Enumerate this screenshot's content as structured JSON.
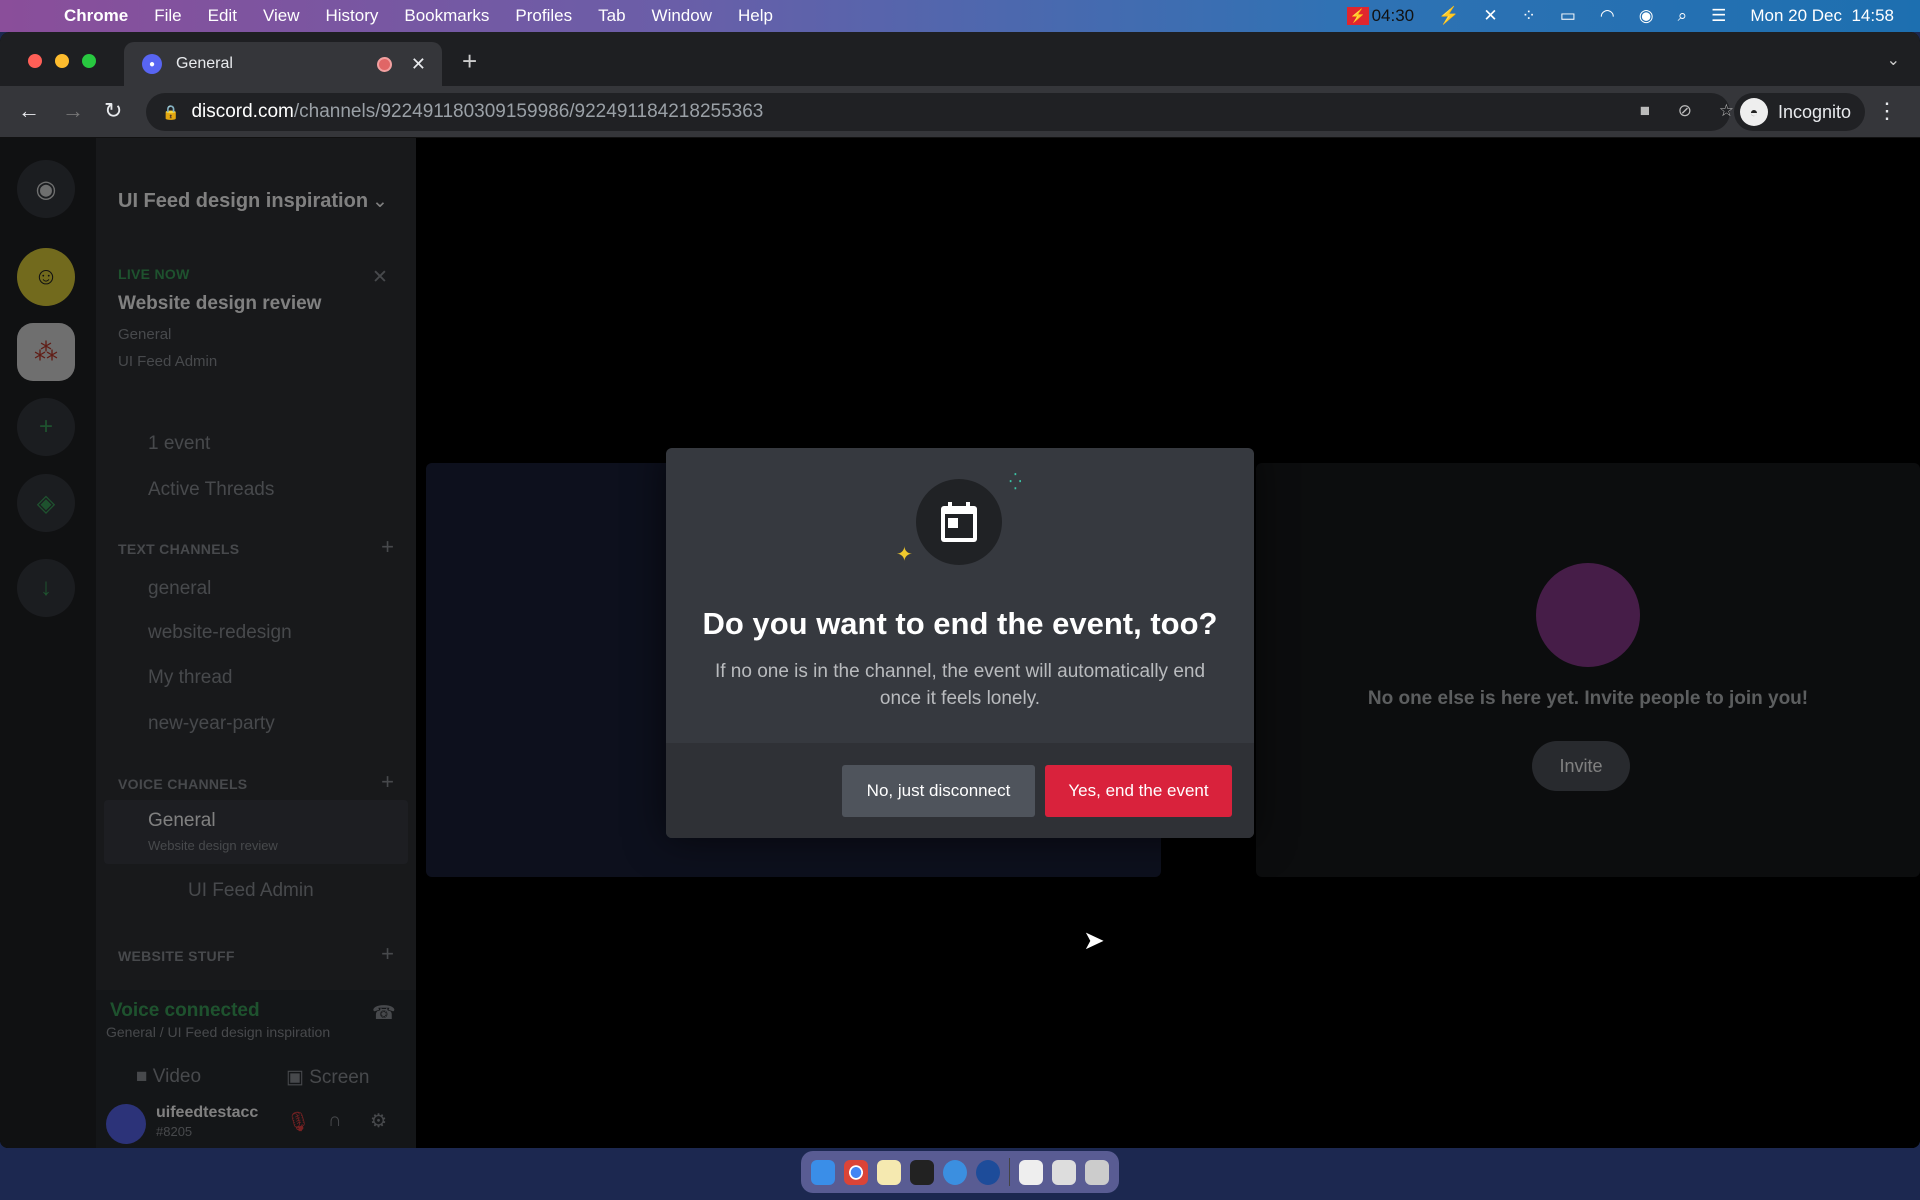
{
  "menubar": {
    "app": "Chrome",
    "items": [
      "File",
      "Edit",
      "View",
      "History",
      "Bookmarks",
      "Profiles",
      "Tab",
      "Window",
      "Help"
    ],
    "recording_time": "04:30",
    "datetime": "Mon 20 Dec  14:58"
  },
  "browser": {
    "tab_title": "General",
    "url_host": "discord.com",
    "url_path": "/channels/922491180309159986/922491184218255363",
    "profile": "Incognito"
  },
  "server": {
    "name": "UI Feed design inspiration",
    "live": {
      "label": "LIVE NOW",
      "title": "Website design review",
      "channel": "General",
      "host": "UI Feed Admin"
    },
    "events": "1 event",
    "threads": "Active Threads",
    "text_category": "TEXT CHANNELS",
    "text_channels": [
      "general",
      "website-redesign",
      "My thread",
      "new-year-party"
    ],
    "voice_category": "VOICE CHANNELS",
    "voice_channel": "General",
    "voice_sub": "Website design review",
    "voice_member": "UI Feed Admin",
    "other_category": "WEBSITE STUFF",
    "voice_status": "Voice connected",
    "voice_location": "General / UI Feed design inspiration",
    "video": "Video",
    "screen": "Screen",
    "user": {
      "name": "uifeedtestacc",
      "tag": "#8205"
    }
  },
  "call": {
    "empty_text": "No one else is here yet. Invite people to join you!",
    "invite": "Invite"
  },
  "modal": {
    "title": "Do you want to end the event, too?",
    "body": "If no one is in the channel, the event will automatically end once it feels lonely.",
    "cancel": "No, just disconnect",
    "confirm": "Yes, end the event",
    "confirm_color": "#d9223c"
  }
}
